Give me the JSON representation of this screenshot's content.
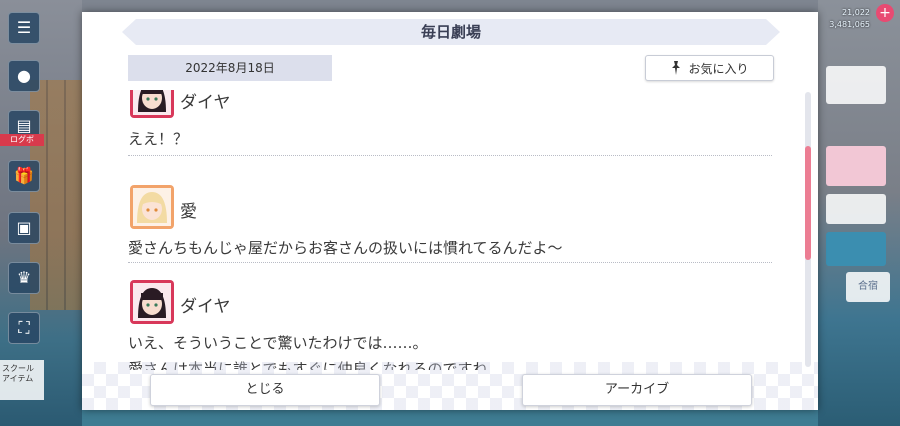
{
  "modal": {
    "title": "毎日劇場",
    "date": "2022年8月18日",
    "favorite_label": "お気に入り",
    "close_label": "とじる",
    "archive_label": "アーカイブ"
  },
  "messages": [
    {
      "speaker": "ダイヤ",
      "lines": [
        "ええ！？"
      ]
    },
    {
      "speaker": "愛",
      "lines": [
        "愛さんちもんじゃ屋だからお客さんの扱いには慣れてるんだよ〜"
      ]
    },
    {
      "speaker": "ダイヤ",
      "lines": [
        "いえ、そういうことで驚いたわけでは……。",
        "愛さんは本当に誰とでもすぐに仲良くなれるのですね"
      ]
    }
  ],
  "background": {
    "resource_1": "21,022",
    "resource_2": "3,481,065",
    "side_badge": "ログボ",
    "side_label": "スクール\nアイテム",
    "tile_cheer": "合宿"
  },
  "colors": {
    "accent": "#ec7d93",
    "header_bg": "#e7eaf4",
    "date_bg": "#dcdfec"
  },
  "icons": {
    "favorite": "pin-icon",
    "avatar_dia": "dia-avatar-icon",
    "avatar_ai": "ai-avatar-icon"
  }
}
